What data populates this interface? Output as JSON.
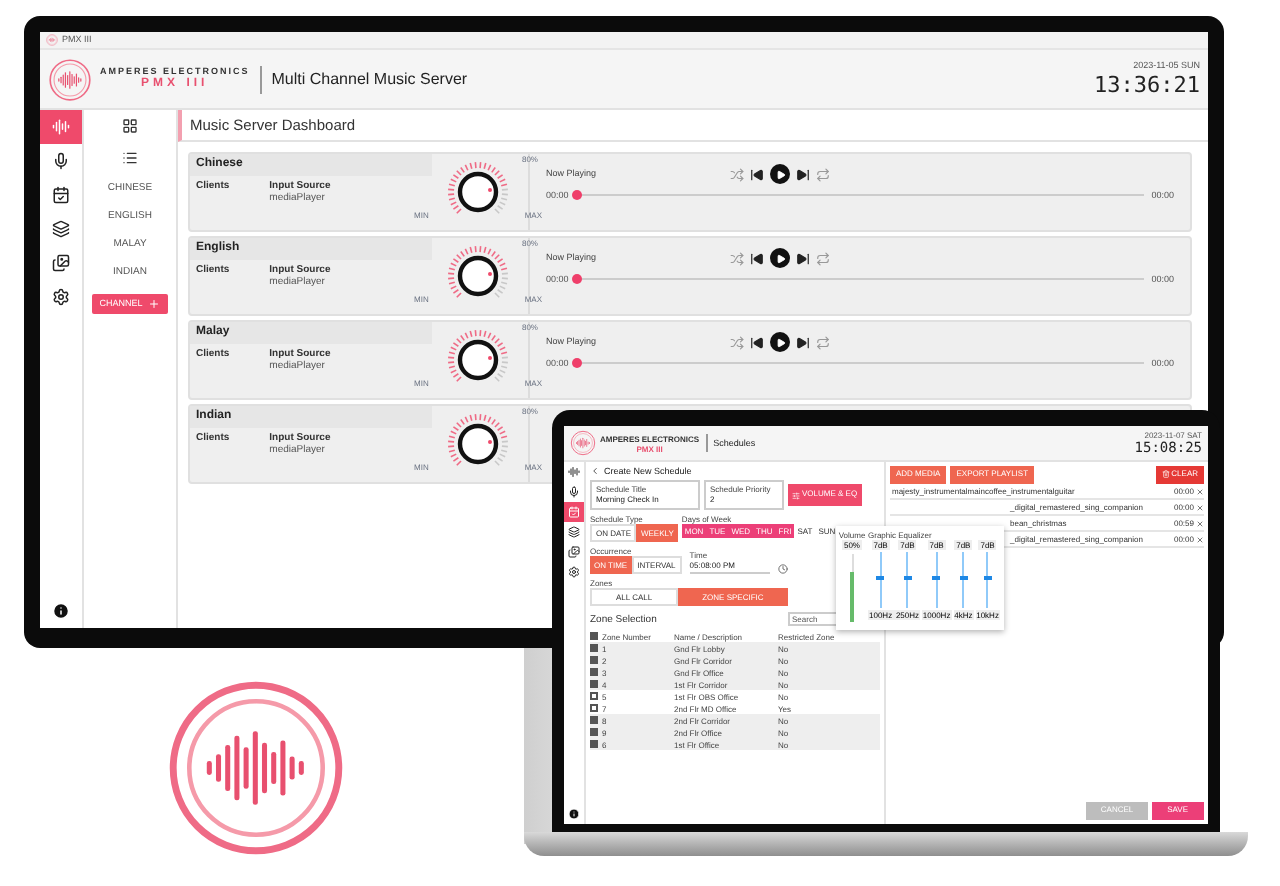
{
  "monitor": {
    "title_bar": "PMX III",
    "brand": "AMPERES ELECTRONICS",
    "product": "PMX III",
    "app_title": "Multi Channel Music Server",
    "date": "2023-11-05 SUN",
    "time": "13:36:21",
    "rail": [
      {
        "kind": "equalizer",
        "selected": true
      },
      {
        "kind": "mic",
        "selected": false
      },
      {
        "kind": "calendar",
        "selected": false
      },
      {
        "kind": "layers",
        "selected": false
      },
      {
        "kind": "gallery",
        "selected": false
      },
      {
        "kind": "settings",
        "selected": false
      }
    ],
    "nav": {
      "items": [
        "CHINESE",
        "ENGLISH",
        "MALAY",
        "INDIAN"
      ],
      "button": "CHANNEL"
    },
    "page_title": "Music Server Dashboard",
    "channels": [
      {
        "name": "Chinese",
        "clients": "Clients",
        "input_label": "Input Source",
        "input": "mediaPlayer",
        "volume": "80%",
        "min": "MIN",
        "max": "MAX",
        "now_playing": "Now Playing",
        "start": "00:00",
        "end": "00:00",
        "level": 0
      },
      {
        "name": "English",
        "clients": "Clients",
        "input_label": "Input Source",
        "input": "mediaPlayer",
        "volume": "80%",
        "min": "MIN",
        "max": "MAX",
        "now_playing": "Now Playing",
        "start": "00:00",
        "end": "00:00",
        "level": 0
      },
      {
        "name": "Malay",
        "clients": "Clients",
        "input_label": "Input Source",
        "input": "mediaPlayer",
        "volume": "80%",
        "min": "MIN",
        "max": "MAX",
        "now_playing": "Now Playing",
        "start": "00:00",
        "end": "00:00",
        "level": 0
      },
      {
        "name": "Indian",
        "clients": "Clients",
        "input_label": "Input Source",
        "input": "mediaPlayer",
        "volume": "80%",
        "min": "MIN",
        "max": "MAX"
      }
    ]
  },
  "laptop": {
    "brand": "AMPERES ELECTRONICS",
    "product": "PMX III",
    "page": "Schedules",
    "date": "2023-11-07 SAT",
    "time": "15:08:25",
    "rail": [
      {
        "kind": "equalizer",
        "selected": false
      },
      {
        "kind": "mic",
        "selected": false
      },
      {
        "kind": "calendar",
        "selected": true
      },
      {
        "kind": "layers",
        "selected": false
      },
      {
        "kind": "gallery",
        "selected": false
      },
      {
        "kind": "settings",
        "selected": false
      }
    ],
    "back_title": "Create New Schedule",
    "title_field": {
      "label": "Schedule Title",
      "value": "Morning Check In"
    },
    "priority_field": {
      "label": "Schedule Priority",
      "value": "2"
    },
    "eq_button": "VOLUME & EQ",
    "schedule_type": {
      "label": "Schedule Type",
      "options": [
        {
          "label": "ON DATE",
          "selected": false
        },
        {
          "label": "WEEKLY",
          "selected": true
        }
      ]
    },
    "days": {
      "label": "Days of Week",
      "options": [
        {
          "label": "MON",
          "selected": true
        },
        {
          "label": "TUE",
          "selected": true
        },
        {
          "label": "WED",
          "selected": true
        },
        {
          "label": "THU",
          "selected": true
        },
        {
          "label": "FRI",
          "selected": true
        },
        {
          "label": "SAT",
          "selected": false
        },
        {
          "label": "SUN",
          "selected": false
        }
      ]
    },
    "occurrence": {
      "label": "Occurrence",
      "options": [
        {
          "label": "ON TIME",
          "selected": true
        },
        {
          "label": "INTERVAL",
          "selected": false
        }
      ]
    },
    "time_field": {
      "label": "Time",
      "value": "05:08:00 PM"
    },
    "zones": {
      "label": "Zones",
      "options": [
        {
          "label": "ALL CALL",
          "selected": false
        },
        {
          "label": "ZONE SPECIFIC",
          "selected": true
        }
      ]
    },
    "zone_table": {
      "title": "Zone Selection",
      "search_placeholder": "Search",
      "select_all_checked": true,
      "columns": [
        "Zone Number",
        "Name / Description",
        "Restricted Zone"
      ],
      "rows": [
        {
          "checked": true,
          "cells": [
            "1",
            "Gnd Flr Lobby",
            "No"
          ]
        },
        {
          "checked": true,
          "cells": [
            "2",
            "Gnd Flr Corridor",
            "No"
          ]
        },
        {
          "checked": true,
          "cells": [
            "3",
            "Gnd Flr Office",
            "No"
          ]
        },
        {
          "checked": true,
          "cells": [
            "4",
            "1st Flr Corridor",
            "No"
          ]
        },
        {
          "checked": false,
          "cells": [
            "5",
            "1st Flr OBS Office",
            "No"
          ]
        },
        {
          "checked": false,
          "cells": [
            "7",
            "2nd Flr MD Office",
            "Yes"
          ]
        },
        {
          "checked": true,
          "cells": [
            "8",
            "2nd Flr Corridor",
            "No"
          ]
        },
        {
          "checked": true,
          "cells": [
            "9",
            "2nd Flr Office",
            "No"
          ]
        },
        {
          "checked": true,
          "cells": [
            "6",
            "1st Flr Office",
            "No"
          ]
        }
      ]
    },
    "eq": {
      "volume_label": "Volume",
      "volume_value": "50%",
      "volume": {
        "level": 0.75
      },
      "eq_label": "Graphic Equalizer",
      "bands": [
        {
          "gain": "7dB",
          "freq": "100Hz",
          "level": 0.5
        },
        {
          "gain": "7dB",
          "freq": "250Hz",
          "level": 0.5
        },
        {
          "gain": "7dB",
          "freq": "1000Hz",
          "level": 0.5
        },
        {
          "gain": "7dB",
          "freq": "4kHz",
          "level": 0.5
        },
        {
          "gain": "7dB",
          "freq": "10kHz",
          "level": 0.5
        }
      ]
    },
    "playlist": {
      "buttons": [
        "ADD MEDIA",
        "EXPORT PLAYLIST"
      ],
      "clear": "CLEAR",
      "items": [
        {
          "name": "majesty_instrumentalmaincoffee_instrumentalguitar",
          "duration": "00:00"
        },
        {
          "name": "_digital_remastered_sing_companion",
          "duration": "00:00"
        },
        {
          "name": "bean_christmas",
          "duration": "00:59"
        },
        {
          "name": "_digital_remastered_sing_companion",
          "duration": "00:00"
        }
      ]
    },
    "footer": {
      "cancel": "CANCEL",
      "save": "SAVE"
    }
  }
}
